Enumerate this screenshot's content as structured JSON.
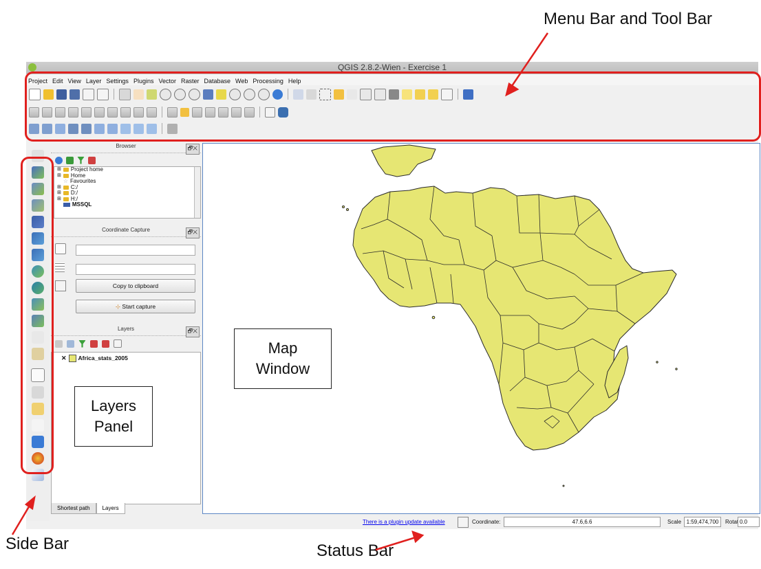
{
  "window": {
    "title": "QGIS 2.8.2-Wien - Exercise 1"
  },
  "menubar": {
    "items": [
      "Project",
      "Edit",
      "View",
      "Layer",
      "Settings",
      "Plugins",
      "Vector",
      "Raster",
      "Database",
      "Web",
      "Processing",
      "Help"
    ]
  },
  "panels": {
    "browser": {
      "title": "Browser",
      "items": [
        "Project home",
        "Home",
        "Favourites",
        "C:/",
        "D:/",
        "H:/",
        "MSSQL"
      ]
    },
    "coordinate_capture": {
      "title": "Coordinate Capture",
      "copy_button": "Copy to clipboard",
      "start_button": "Start capture"
    },
    "layers": {
      "title": "Layers",
      "layer_name": "Africa_stats_2005",
      "layer_visible_mark": "✕"
    },
    "dock_control": "🗗✕"
  },
  "bottom_tabs": [
    "Shortest path",
    "Layers"
  ],
  "statusbar": {
    "plugin_link": "There is a plugin update available",
    "coordinate_label": "Coordinate:",
    "coordinate_value": "47.6,6.6",
    "scale_label": "Scale",
    "scale_value": "1:59,474,700",
    "rotation_label": "Rotation:",
    "rotation_value": "0.0"
  },
  "annotations": {
    "menu_toolbar": "Menu Bar and Tool Bar",
    "side_bar": "Side Bar",
    "status_bar": "Status Bar",
    "layers_panel_line1": "Layers",
    "layers_panel_line2": "Panel",
    "map_window_line1": "Map",
    "map_window_line2": "Window"
  },
  "colors": {
    "annotation_red": "#e0201e",
    "country_fill": "#e6e673",
    "country_stroke": "#2a2a2a",
    "map_border": "#5b86c4"
  }
}
